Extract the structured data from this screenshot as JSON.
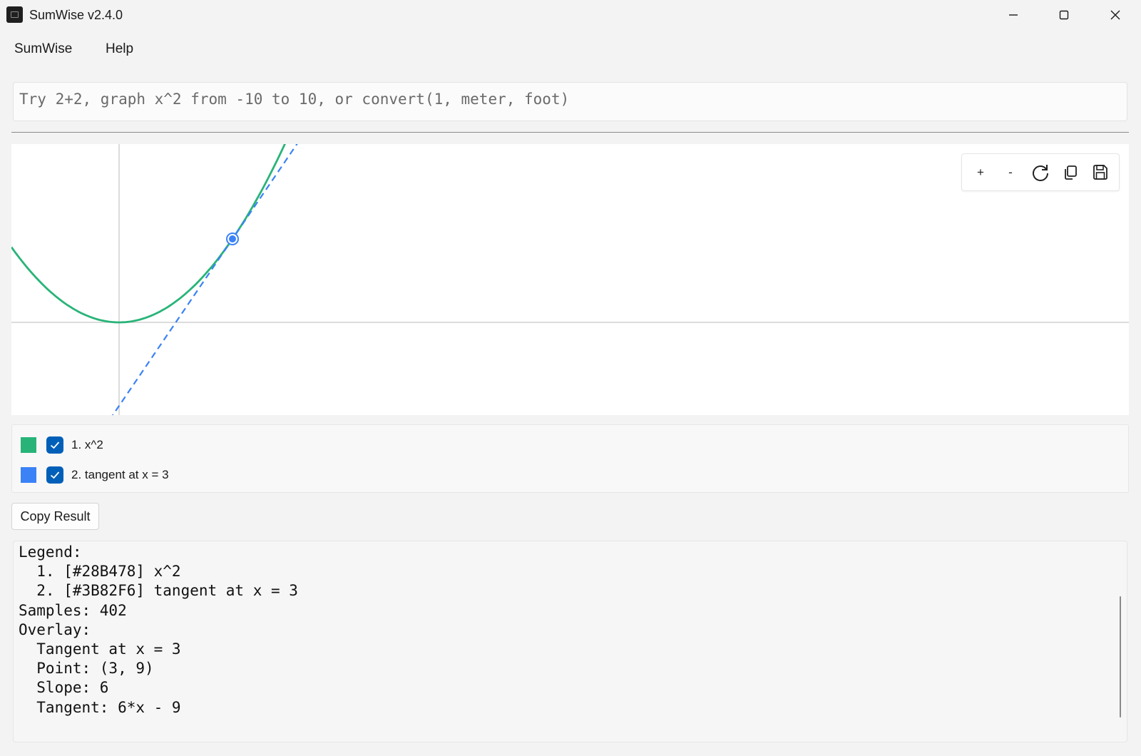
{
  "window": {
    "title": "SumWise v2.4.0",
    "icons": [
      "app-icon",
      "minimize-icon",
      "maximize-icon",
      "close-icon"
    ]
  },
  "menu": {
    "items": [
      "SumWise",
      "Help"
    ]
  },
  "input": {
    "placeholder": "Try 2+2, graph x^2 from -10 to 10, or convert(1, meter, foot)",
    "value": ""
  },
  "graph_toolbar": {
    "zoom_in": "+",
    "zoom_out": "-",
    "icons": [
      "zoom-in-icon",
      "zoom-out-icon",
      "reset-view-icon",
      "copy-icon",
      "save-icon"
    ]
  },
  "chart_data": {
    "type": "line",
    "grid": false,
    "series": [
      {
        "name": "1. x^2",
        "color": "#28B478",
        "expression": "x^2",
        "style": "solid"
      },
      {
        "name": "2. tangent at x = 3",
        "color": "#3B82F6",
        "expression": "6*x - 9",
        "style": "dashed"
      }
    ],
    "point": {
      "x": 3,
      "y": 9
    }
  },
  "legend": {
    "items": [
      {
        "label": "1. x^2",
        "color": "#28B478",
        "checked": true
      },
      {
        "label": "2. tangent at x = 3",
        "color": "#3B82F6",
        "checked": true
      }
    ]
  },
  "actions": {
    "copy_label": "Copy Result"
  },
  "output": {
    "lines": [
      "Legend:",
      "  1. [#28B478] x^2",
      "  2. [#3B82F6] tangent at x = 3",
      "Samples: 402",
      "Overlay:",
      "  Tangent at x = 3",
      "  Point: (3, 9)",
      "  Slope: 6",
      "  Tangent: 6*x - 9"
    ]
  },
  "colors": {
    "accent": "#005fb8",
    "curve": "#28B478",
    "tangent": "#3B82F6"
  }
}
